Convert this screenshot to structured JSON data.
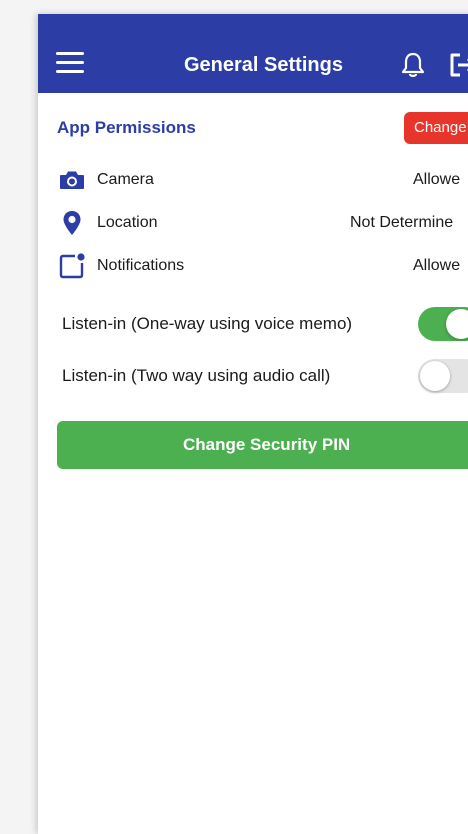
{
  "header": {
    "title": "General Settings",
    "menu_icon": "hamburger-menu-icon",
    "bell_icon": "bell-icon",
    "logout_icon": "logout-icon",
    "bg_color": "#2c3ea6"
  },
  "permissions": {
    "section_title": "App Permissions",
    "change_button": "Change",
    "items": [
      {
        "icon": "camera-icon",
        "label": "Camera",
        "status": "Allowe"
      },
      {
        "icon": "location-pin-icon",
        "label": "Location",
        "status": "Not Determine"
      },
      {
        "icon": "notification-badge-icon",
        "label": "Notifications",
        "status": "Allowe"
      }
    ]
  },
  "listen_in": [
    {
      "label": "Listen-in (One-way using voice memo)",
      "enabled": true
    },
    {
      "label": "Listen-in (Two way using audio call)",
      "enabled": false
    }
  ],
  "security": {
    "pin_button": "Change Security PIN",
    "color": "#4caf50"
  },
  "colors": {
    "accent": "#2c3ea6",
    "danger": "#e8352b",
    "success": "#4caf50"
  }
}
